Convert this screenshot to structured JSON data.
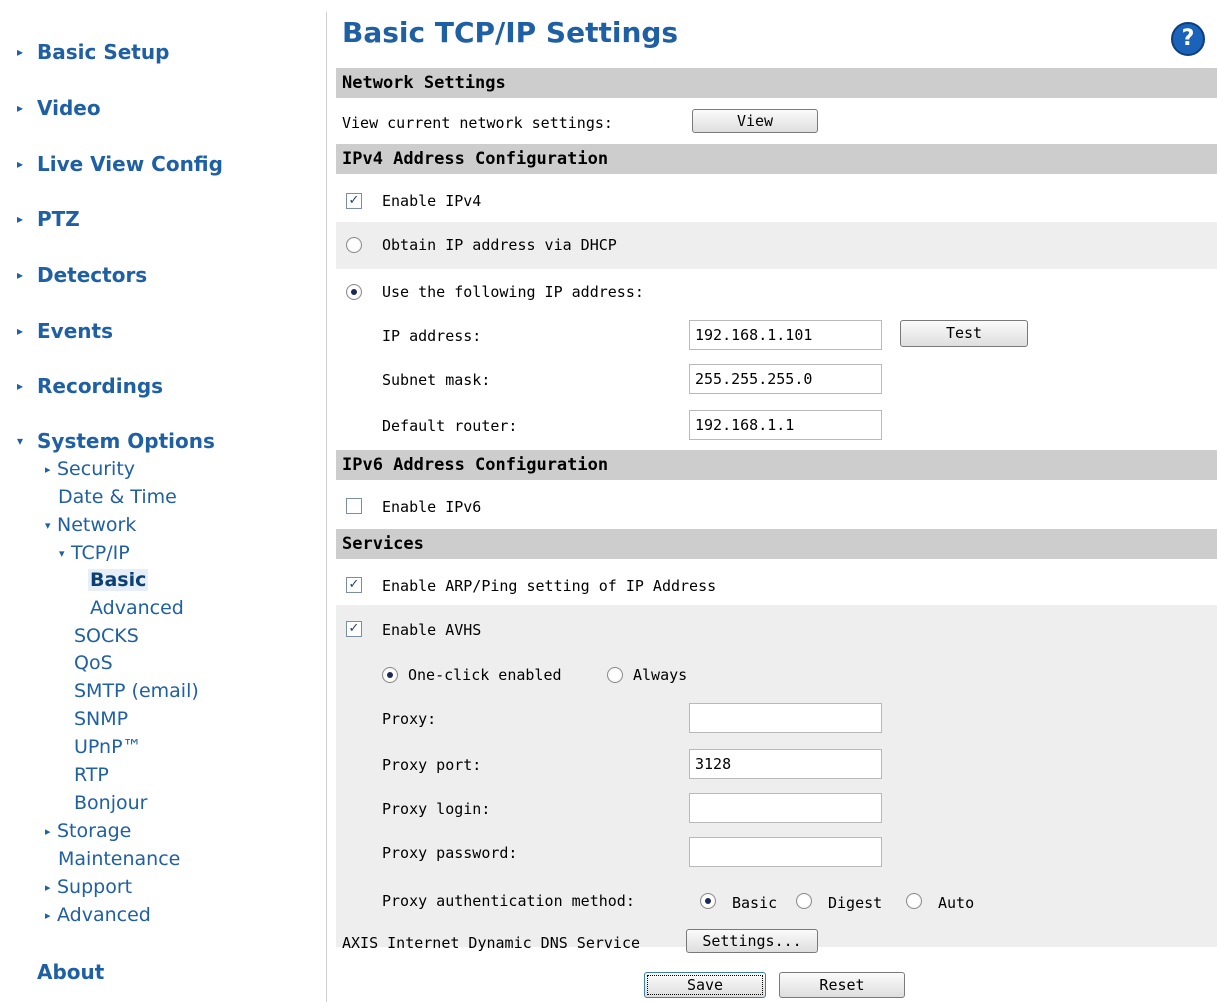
{
  "sidebar": {
    "main_items": [
      {
        "label": "Basic Setup"
      },
      {
        "label": "Video"
      },
      {
        "label": "Live View Config"
      },
      {
        "label": "PTZ"
      },
      {
        "label": "Detectors"
      },
      {
        "label": "Events"
      },
      {
        "label": "Recordings"
      },
      {
        "label": "System Options"
      }
    ],
    "sub_items": {
      "security": "Security",
      "date_time": "Date & Time",
      "network": "Network",
      "tcpip": "TCP/IP",
      "basic": "Basic",
      "advanced_tcpip": "Advanced",
      "socks": "SOCKS",
      "qos": "QoS",
      "smtp": "SMTP (email)",
      "snmp": "SNMP",
      "upnp": "UPnP™",
      "rtp": "RTP",
      "bonjour": "Bonjour",
      "storage": "Storage",
      "maintenance": "Maintenance",
      "support": "Support",
      "advanced": "Advanced"
    },
    "about": "About"
  },
  "header": {
    "title": "Basic TCP/IP Settings",
    "help_icon": "?"
  },
  "network_settings": {
    "heading": "Network Settings",
    "view_label": "View current network settings:",
    "view_button": "View"
  },
  "ipv4": {
    "heading": "IPv4 Address Configuration",
    "enable_label": "Enable IPv4",
    "enable_checked": true,
    "dhcp_label": "Obtain IP address via DHCP",
    "static_label": "Use the following IP address:",
    "ip_label": "IP address:",
    "ip_value": "192.168.1.101",
    "test_button": "Test",
    "subnet_label": "Subnet mask:",
    "subnet_value": "255.255.255.0",
    "router_label": "Default router:",
    "router_value": "192.168.1.1"
  },
  "ipv6": {
    "heading": "IPv6 Address Configuration",
    "enable_label": "Enable IPv6",
    "enable_checked": false
  },
  "services": {
    "heading": "Services",
    "arp_label": "Enable ARP/Ping setting of IP Address",
    "avhs_label": "Enable AVHS",
    "one_click_label": "One-click enabled",
    "always_label": "Always",
    "proxy_label": "Proxy:",
    "proxy_value": "",
    "proxy_port_label": "Proxy port:",
    "proxy_port_value": "3128",
    "proxy_login_label": "Proxy login:",
    "proxy_login_value": "",
    "proxy_password_label": "Proxy password:",
    "proxy_password_value": "",
    "auth_method_label": "Proxy authentication method:",
    "auth_options": [
      "Basic",
      "Digest",
      "Auto"
    ],
    "auth_selected": "Basic",
    "ddns_label": "AXIS Internet Dynamic DNS Service",
    "ddns_button": "Settings..."
  },
  "footer": {
    "save_button": "Save",
    "reset_button": "Reset"
  },
  "icons": {
    "collapsed_arrow": "▸",
    "expanded_arrow": "▾",
    "check_mark": "✓"
  }
}
